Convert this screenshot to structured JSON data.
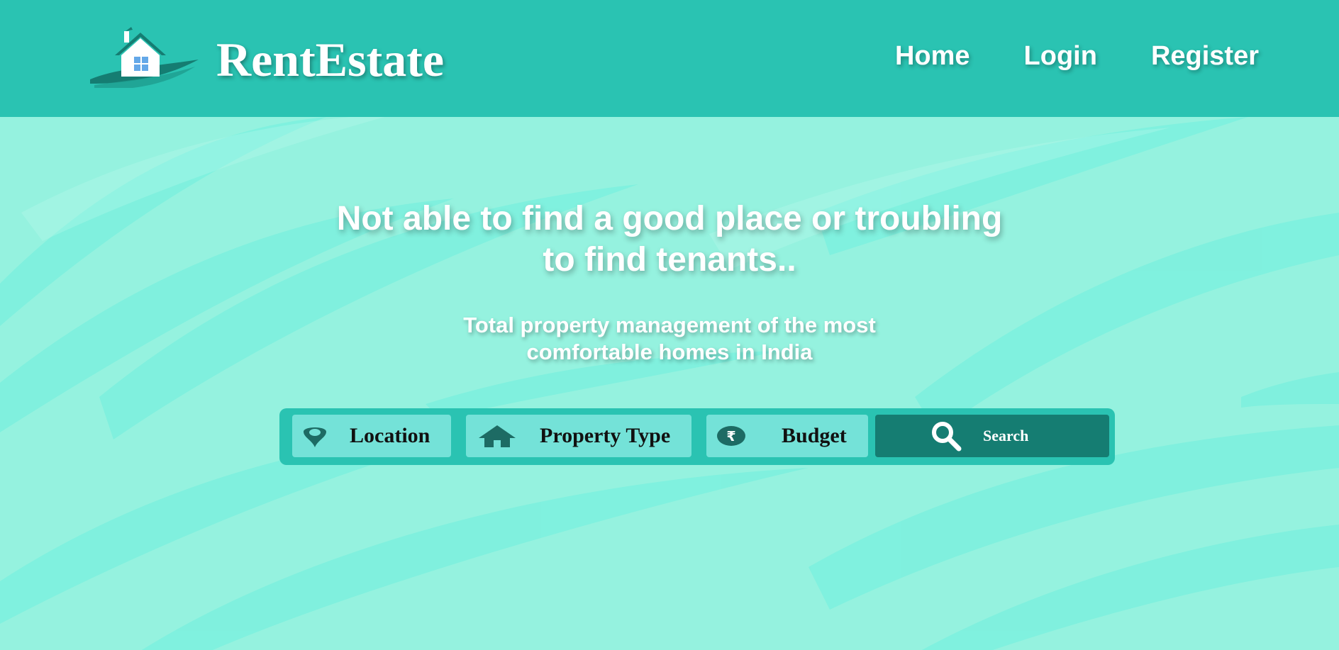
{
  "brand": {
    "name": "RentEstate",
    "logo_icon": "house-logo-icon"
  },
  "nav": {
    "home": "Home",
    "login": "Login",
    "register": "Register"
  },
  "hero": {
    "title_line1": "Not able to find a good place or troubling",
    "title_line2": "to find tenants..",
    "subtitle_line1": "Total property management of the most",
    "subtitle_line2": "comfortable homes in India"
  },
  "search": {
    "location": {
      "label": "Location",
      "icon": "map-pin-icon"
    },
    "property_type": {
      "label": "Property Type",
      "icon": "house-icon"
    },
    "budget": {
      "label": "Budget",
      "icon": "rupee-icon",
      "symbol": "₹"
    },
    "button": {
      "label": "Search",
      "icon": "magnifier-icon"
    }
  },
  "colors": {
    "header": "#2ac3b2",
    "background": "#95f2df",
    "field": "#74e2d8",
    "search_button": "#157d72",
    "text": "#ffffff"
  }
}
